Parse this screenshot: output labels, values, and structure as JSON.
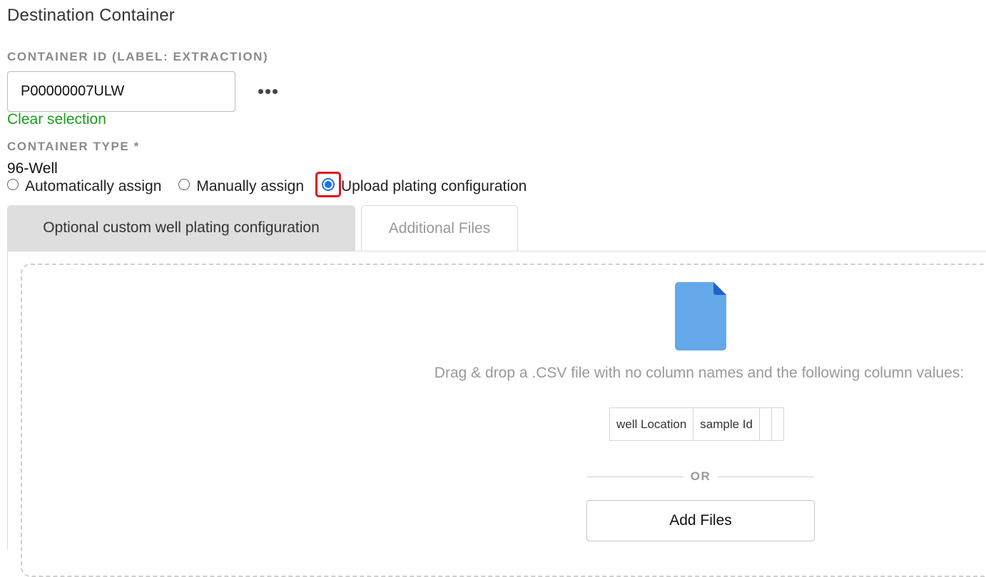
{
  "section": {
    "title": "Destination Container"
  },
  "container_id": {
    "label": "CONTAINER ID (LABEL: EXTRACTION)",
    "value": "P00000007ULW",
    "more_icon": "more-horizontal-icon",
    "clear_label": "Clear selection"
  },
  "container_type": {
    "label": "CONTAINER TYPE *",
    "value": "96-Well"
  },
  "assignment": {
    "options": [
      {
        "label": "Automatically assign",
        "checked": false
      },
      {
        "label": "Manually assign",
        "checked": false
      },
      {
        "label": "Upload plating configuration",
        "checked": true
      }
    ],
    "highlight_color": "#e2141b",
    "accent_color": "#1a73e8"
  },
  "tabs": [
    {
      "label": "Optional custom well plating configuration",
      "active": true
    },
    {
      "label": "Additional Files",
      "active": false
    }
  ],
  "dropzone": {
    "icon": "file-icon",
    "icon_color": "#64a8ea",
    "instructions": "Drag & drop a .CSV file with no column names and the following column values:",
    "columns": [
      "well Location",
      "sample Id",
      "",
      ""
    ],
    "or_label": "OR",
    "add_files_label": "Add Files"
  },
  "colors": {
    "link_green": "#17a017",
    "label_gray": "#8a8a8a"
  }
}
